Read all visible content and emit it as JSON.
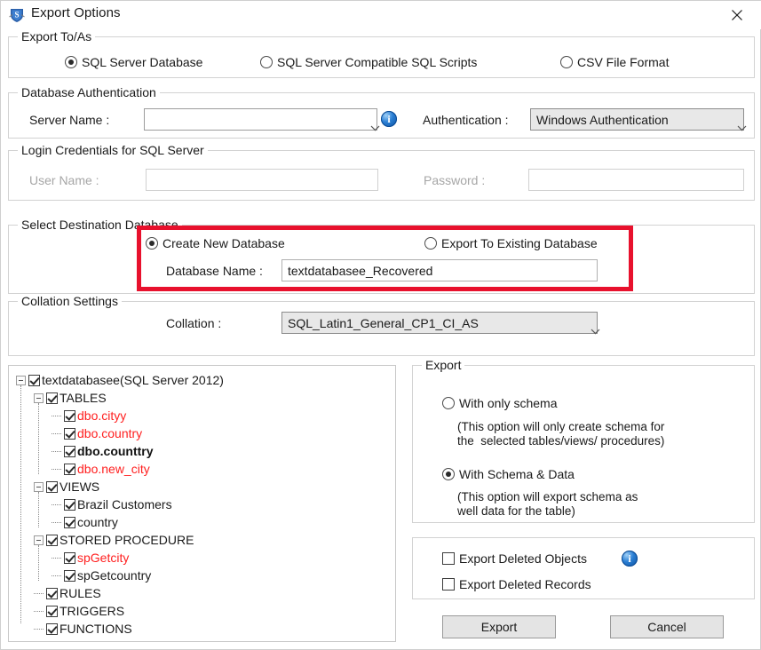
{
  "window": {
    "title": "Export Options",
    "app_icon": "shield-logo-icon",
    "close_icon": "close-icon"
  },
  "export_to_as": {
    "group_label": "Export To/As",
    "options": [
      {
        "label": "SQL Server Database",
        "selected": true
      },
      {
        "label": "SQL Server Compatible SQL Scripts",
        "selected": false
      },
      {
        "label": "CSV File Format",
        "selected": false
      }
    ]
  },
  "database_authentication": {
    "group_label": "Database Authentication",
    "server_name_label": "Server Name :",
    "server_name_value": "",
    "server_name_placeholder": "",
    "info_icon": "info-icon",
    "authentication_label": "Authentication :",
    "authentication_value": "Windows Authentication"
  },
  "login_credentials": {
    "group_label": "Login Credentials for SQL Server",
    "user_name_label": "User Name :",
    "user_name_value": "",
    "password_label": "Password :",
    "password_value": ""
  },
  "select_destination_database": {
    "group_label": "Select Destination Database",
    "options": [
      {
        "label": "Create New Database",
        "selected": true
      },
      {
        "label": "Export To Existing Database",
        "selected": false
      }
    ],
    "database_name_label": "Database Name :",
    "database_name_value": "textdatabasee_Recovered",
    "highlight_color": "#e8112d"
  },
  "collation_settings": {
    "group_label": "Collation Settings",
    "collation_label": "Collation :",
    "collation_value": "SQL_Latin1_General_CP1_CI_AS"
  },
  "tree": {
    "nodes": [
      {
        "label": "textdatabasee(SQL Server 2012)",
        "depth": 0,
        "expander": true,
        "checked": true,
        "style": "normal"
      },
      {
        "label": "TABLES",
        "depth": 1,
        "expander": true,
        "checked": true,
        "style": "normal"
      },
      {
        "label": "dbo.cityy",
        "depth": 2,
        "expander": false,
        "checked": true,
        "style": "red"
      },
      {
        "label": "dbo.country",
        "depth": 2,
        "expander": false,
        "checked": true,
        "style": "red"
      },
      {
        "label": "dbo.counttry",
        "depth": 2,
        "expander": false,
        "checked": true,
        "style": "bold"
      },
      {
        "label": "dbo.new_city",
        "depth": 2,
        "expander": false,
        "checked": true,
        "style": "red"
      },
      {
        "label": "VIEWS",
        "depth": 1,
        "expander": true,
        "checked": true,
        "style": "normal"
      },
      {
        "label": "Brazil Customers",
        "depth": 2,
        "expander": false,
        "checked": true,
        "style": "normal"
      },
      {
        "label": "country",
        "depth": 2,
        "expander": false,
        "checked": true,
        "style": "normal"
      },
      {
        "label": "STORED PROCEDURE",
        "depth": 1,
        "expander": true,
        "checked": true,
        "style": "normal"
      },
      {
        "label": "spGetcity",
        "depth": 2,
        "expander": false,
        "checked": true,
        "style": "red"
      },
      {
        "label": "spGetcountry",
        "depth": 2,
        "expander": false,
        "checked": true,
        "style": "normal"
      },
      {
        "label": "RULES",
        "depth": 1,
        "expander": false,
        "checked": true,
        "style": "normal"
      },
      {
        "label": "TRIGGERS",
        "depth": 1,
        "expander": false,
        "checked": true,
        "style": "normal"
      },
      {
        "label": "FUNCTIONS",
        "depth": 1,
        "expander": false,
        "checked": true,
        "style": "normal"
      }
    ],
    "deleted_item_color": "#ff2020"
  },
  "export_panel": {
    "group_label": "Export",
    "options": [
      {
        "label": "With only schema",
        "selected": false,
        "note": "(This option will only create schema for\nthe  selected tables/views/ procedures)"
      },
      {
        "label": "With Schema & Data",
        "selected": true,
        "note": "(This option will export schema as\nwell data for the table)"
      }
    ]
  },
  "deleted_options": {
    "checkboxes": [
      {
        "label": "Export Deleted Objects",
        "checked": false,
        "has_info": true
      },
      {
        "label": "Export Deleted Records",
        "checked": false,
        "has_info": false
      }
    ],
    "info_icon": "info-icon"
  },
  "actions": {
    "export_label": "Export",
    "cancel_label": "Cancel"
  }
}
